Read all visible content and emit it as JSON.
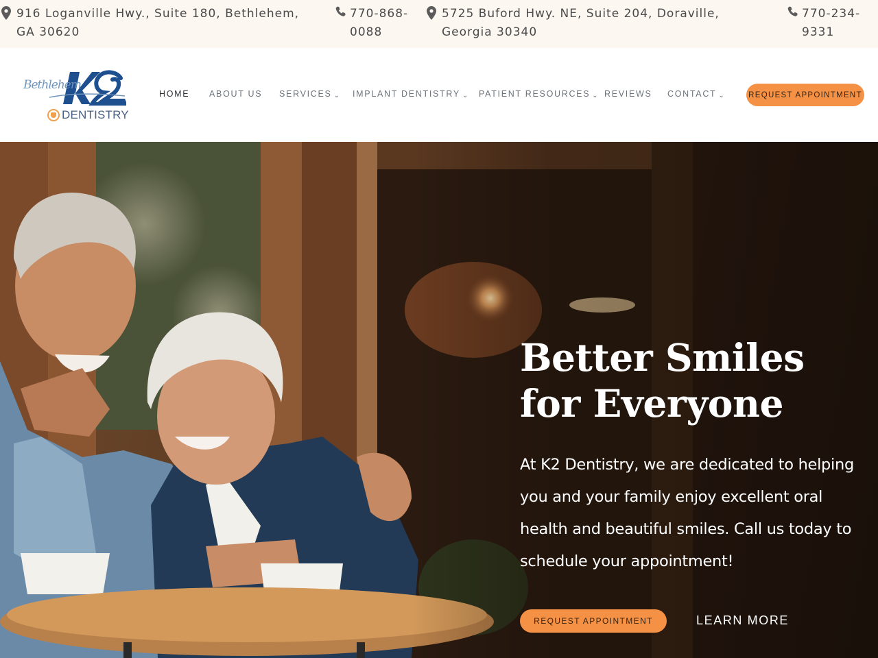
{
  "topbar": {
    "address_1": "916 Loganville Hwy., Suite 180, Bethlehem, GA 30620",
    "phone_1": "770-868-0088",
    "address_2": "5725 Buford Hwy. NE, Suite 204, Doraville, Georgia 30340",
    "phone_2": "770-234-9331",
    "location_icon": "map-pin-icon",
    "phone_icon": "phone-icon"
  },
  "logo": {
    "script_text": "Bethlehem",
    "wordmark": "DENTISTRY",
    "colors": {
      "navy": "#1e4f8f",
      "orange": "#f0a04b"
    }
  },
  "nav": {
    "items": [
      {
        "label": "HOME",
        "active": true,
        "dropdown": false
      },
      {
        "label": "ABOUT US",
        "active": false,
        "dropdown": false
      },
      {
        "label": "SERVICES",
        "active": false,
        "dropdown": true
      },
      {
        "label": "IMPLANT DENTISTRY",
        "active": false,
        "dropdown": true
      },
      {
        "label": "PATIENT RESOURCES",
        "active": false,
        "dropdown": true
      },
      {
        "label": "REVIEWS",
        "active": false,
        "dropdown": false
      },
      {
        "label": "CONTACT",
        "active": false,
        "dropdown": true
      }
    ],
    "caret": "⌄",
    "cta_label": "REQUEST APPOINTMENT"
  },
  "hero": {
    "title_line_1": "Better Smiles",
    "title_line_2": "for Everyone",
    "body": "At K2 Dentistry, we are dedicated to helping you and your family enjoy excellent oral health and beautiful smiles. Call us today to schedule your appointment!",
    "cta_label": "REQUEST APPOINTMENT",
    "secondary_label": "LEARN MORE"
  },
  "colors": {
    "accent": "#f49145",
    "topbar_bg": "#fdf7f1",
    "nav_text": "#6c727a",
    "nav_active": "#2e3238"
  }
}
